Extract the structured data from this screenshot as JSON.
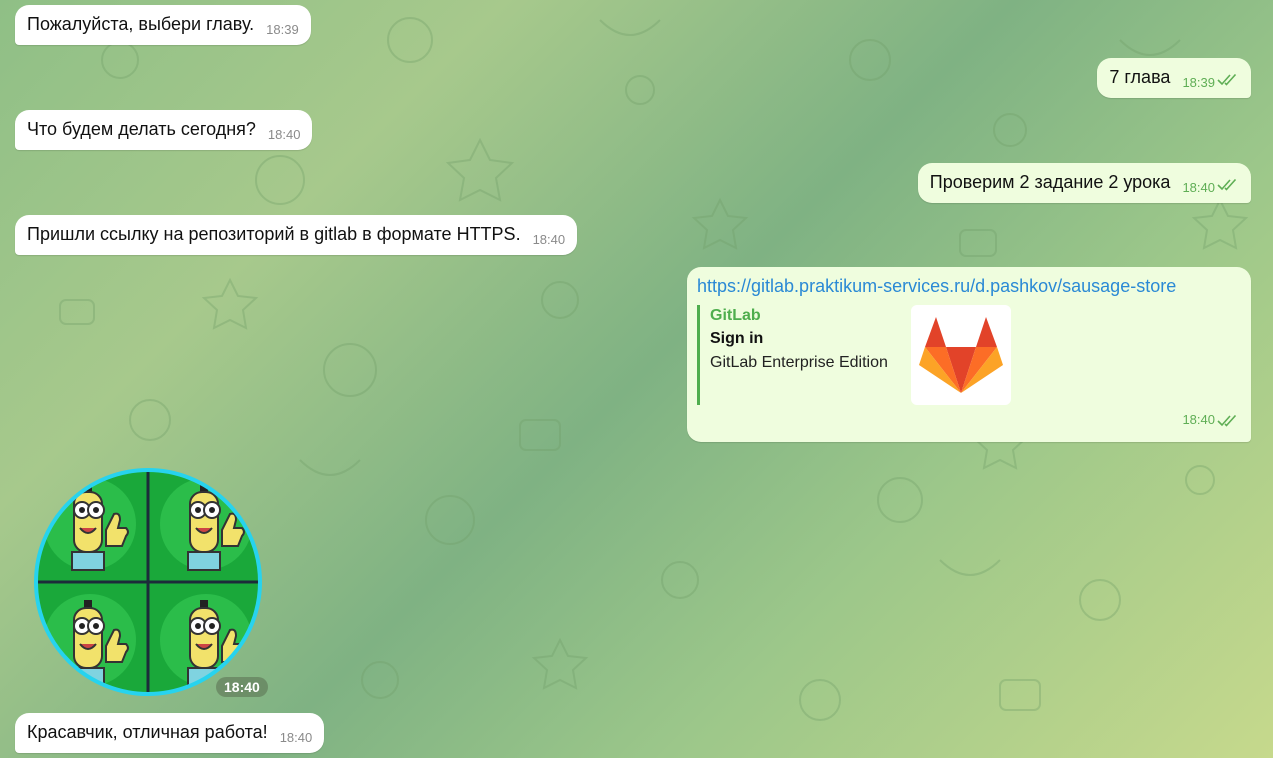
{
  "messages": {
    "m1": {
      "text": "Пожалуйста, выбери главу.",
      "time": "18:39"
    },
    "m2": {
      "text": "7 глава",
      "time": "18:39"
    },
    "m3": {
      "text": "Что будем делать сегодня?",
      "time": "18:40"
    },
    "m4": {
      "text": "Проверим 2 задание 2 урока",
      "time": "18:40"
    },
    "m5": {
      "text": "Пришли ссылку на репозиторий в gitlab в формате HTTPS.",
      "time": "18:40"
    },
    "m6": {
      "url": "https://gitlab.praktikum-services.ru/d.pashkov/sausage-store",
      "preview_site": "GitLab",
      "preview_title": "Sign in",
      "preview_description": "GitLab Enterprise Edition",
      "preview_image": "gitlab-logo-icon",
      "time": "18:40"
    },
    "m7": {
      "sticker": "waving-character-sticker",
      "time": "18:40"
    },
    "m8": {
      "text": "Красавчик, отличная работа!",
      "time": "18:40"
    }
  },
  "colors": {
    "incoming_bubble": "#ffffff",
    "outgoing_bubble": "#effdde",
    "link": "#2a89d5",
    "accent_green": "#4fae4e"
  }
}
